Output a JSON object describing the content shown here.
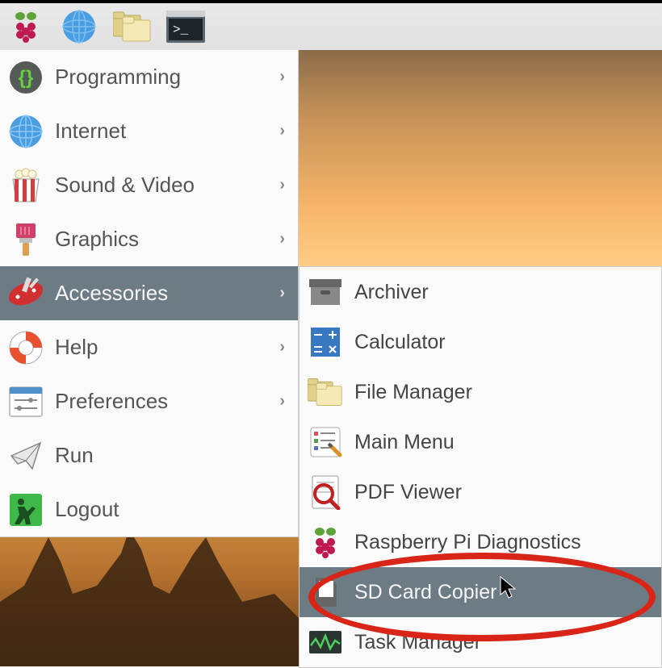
{
  "menu": {
    "items": [
      {
        "label": "Programming",
        "icon": "code",
        "has_submenu": true
      },
      {
        "label": "Internet",
        "icon": "globe",
        "has_submenu": true
      },
      {
        "label": "Sound & Video",
        "icon": "popcorn",
        "has_submenu": true
      },
      {
        "label": "Graphics",
        "icon": "brush",
        "has_submenu": true
      },
      {
        "label": "Accessories",
        "icon": "swiss-knife",
        "has_submenu": true,
        "selected": true
      },
      {
        "label": "Help",
        "icon": "lifebuoy",
        "has_submenu": true
      },
      {
        "label": "Preferences",
        "icon": "sliders",
        "has_submenu": true
      },
      {
        "label": "Run",
        "icon": "paper-plane",
        "has_submenu": false
      },
      {
        "label": "Logout",
        "icon": "exit",
        "has_submenu": false
      }
    ]
  },
  "submenu": {
    "items": [
      {
        "label": "Archiver",
        "icon": "archive"
      },
      {
        "label": "Calculator",
        "icon": "calculator"
      },
      {
        "label": "File Manager",
        "icon": "folders"
      },
      {
        "label": "Main Menu",
        "icon": "mainmenu"
      },
      {
        "label": "PDF Viewer",
        "icon": "magnifier"
      },
      {
        "label": "Raspberry Pi Diagnostics",
        "icon": "raspberry"
      },
      {
        "label": "SD Card Copier",
        "icon": "sdcard",
        "selected": true
      },
      {
        "label": "Task Manager",
        "icon": "taskmanager"
      }
    ]
  }
}
